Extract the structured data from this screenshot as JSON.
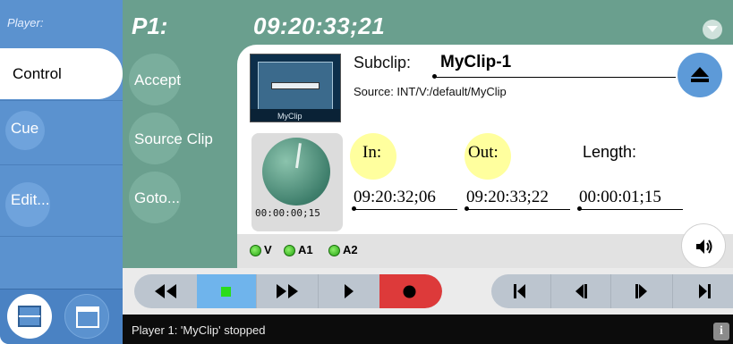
{
  "sidebar": {
    "title": "Player:",
    "items": [
      {
        "label": "Control"
      },
      {
        "label": "Cue"
      },
      {
        "label": "Edit..."
      }
    ]
  },
  "header": {
    "player": "P1:",
    "timecode": "09:20:33;21"
  },
  "actions": {
    "accept": "Accept",
    "source_clip": "Source Clip",
    "goto": "Goto..."
  },
  "clip": {
    "subclip_label": "Subclip:",
    "subclip_name": "MyClip-1",
    "source": "Source: INT/V:/default/MyClip",
    "thumbnail_caption": "MyClip"
  },
  "dial": {
    "timecode": "00:00:00;15"
  },
  "marks": {
    "in_label": "In:",
    "out_label": "Out:",
    "length_label": "Length:",
    "in_value": "09:20:32;06",
    "out_value": "09:20:33;22",
    "length_value": "00:00:01;15"
  },
  "meters": [
    {
      "label": "V"
    },
    {
      "label": "A1"
    },
    {
      "label": "A2"
    }
  ],
  "status": {
    "message": "Player 1: 'MyClip' stopped",
    "info": "i"
  },
  "colors": {
    "sidebar": "#5b92cf",
    "panel": "#6a9f8e",
    "highlight": "#ffff9e",
    "record": "#dd3a3a",
    "stop_active": "#6fb4ec"
  }
}
